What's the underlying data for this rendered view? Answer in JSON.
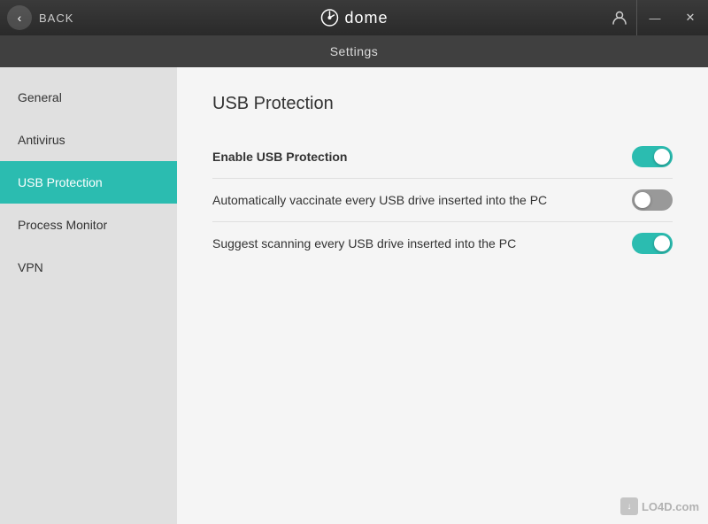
{
  "titlebar": {
    "back_label": "BACK",
    "logo_text": "dome",
    "user_icon": "👤",
    "minimize_label": "—",
    "close_label": "✕"
  },
  "settings_bar": {
    "title": "Settings"
  },
  "sidebar": {
    "items": [
      {
        "id": "general",
        "label": "General",
        "active": false
      },
      {
        "id": "antivirus",
        "label": "Antivirus",
        "active": false
      },
      {
        "id": "usb-protection",
        "label": "USB Protection",
        "active": true
      },
      {
        "id": "process-monitor",
        "label": "Process Monitor",
        "active": false
      },
      {
        "id": "vpn",
        "label": "VPN",
        "active": false
      }
    ]
  },
  "content": {
    "title": "USB Protection",
    "settings": [
      {
        "id": "enable-usb",
        "label": "Enable USB Protection",
        "bold": true,
        "toggle_state": "on"
      },
      {
        "id": "auto-vaccinate",
        "label": "Automatically vaccinate every USB drive inserted into the PC",
        "bold": false,
        "toggle_state": "off"
      },
      {
        "id": "suggest-scan",
        "label": "Suggest scanning every USB drive inserted into the PC",
        "bold": false,
        "toggle_state": "on"
      }
    ]
  },
  "watermark": {
    "text": "LO4D.com"
  }
}
